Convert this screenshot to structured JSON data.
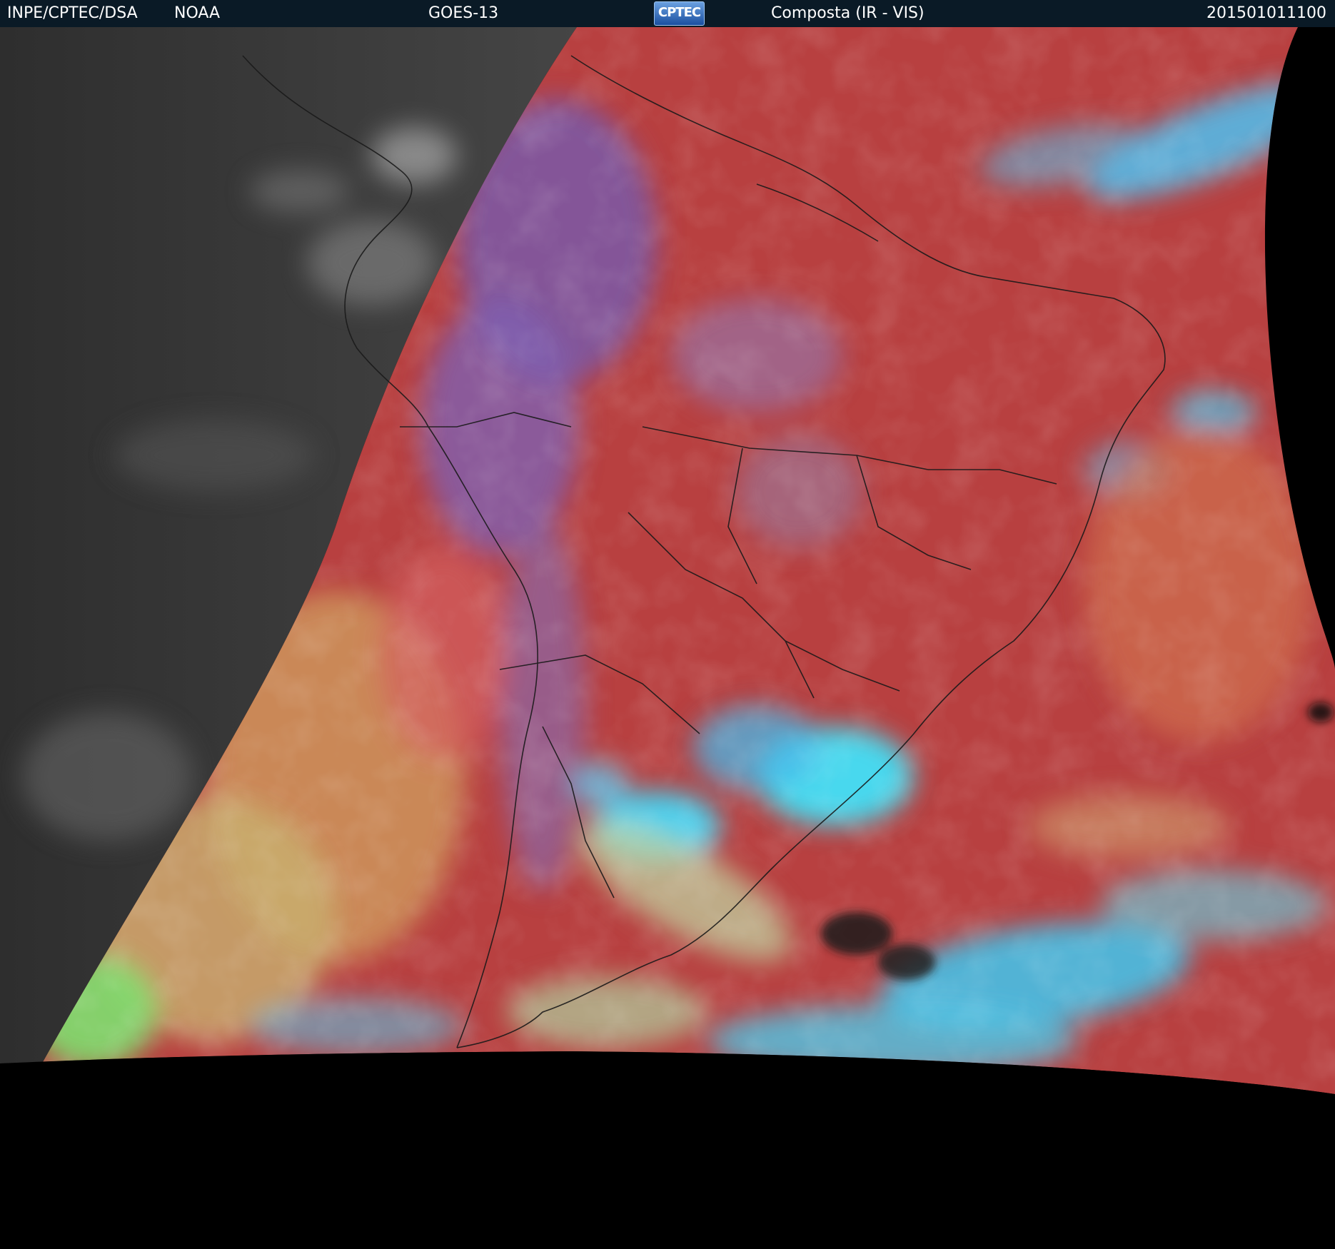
{
  "header": {
    "agency": "INPE/CPTEC/DSA",
    "source": "NOAA",
    "satellite": "GOES-13",
    "logo_text": "CPTEC",
    "product": "Composta (IR - VIS)",
    "timestamp": "201501011100"
  },
  "colors": {
    "header_bg": "#0a1a26",
    "night_side": "#3a3a3a",
    "land_day": "#b84040",
    "cloud_cyan": "#40d8f0",
    "cloud_green": "#90e070",
    "space": "#000000"
  },
  "icons": [
    "cptec-logo"
  ]
}
